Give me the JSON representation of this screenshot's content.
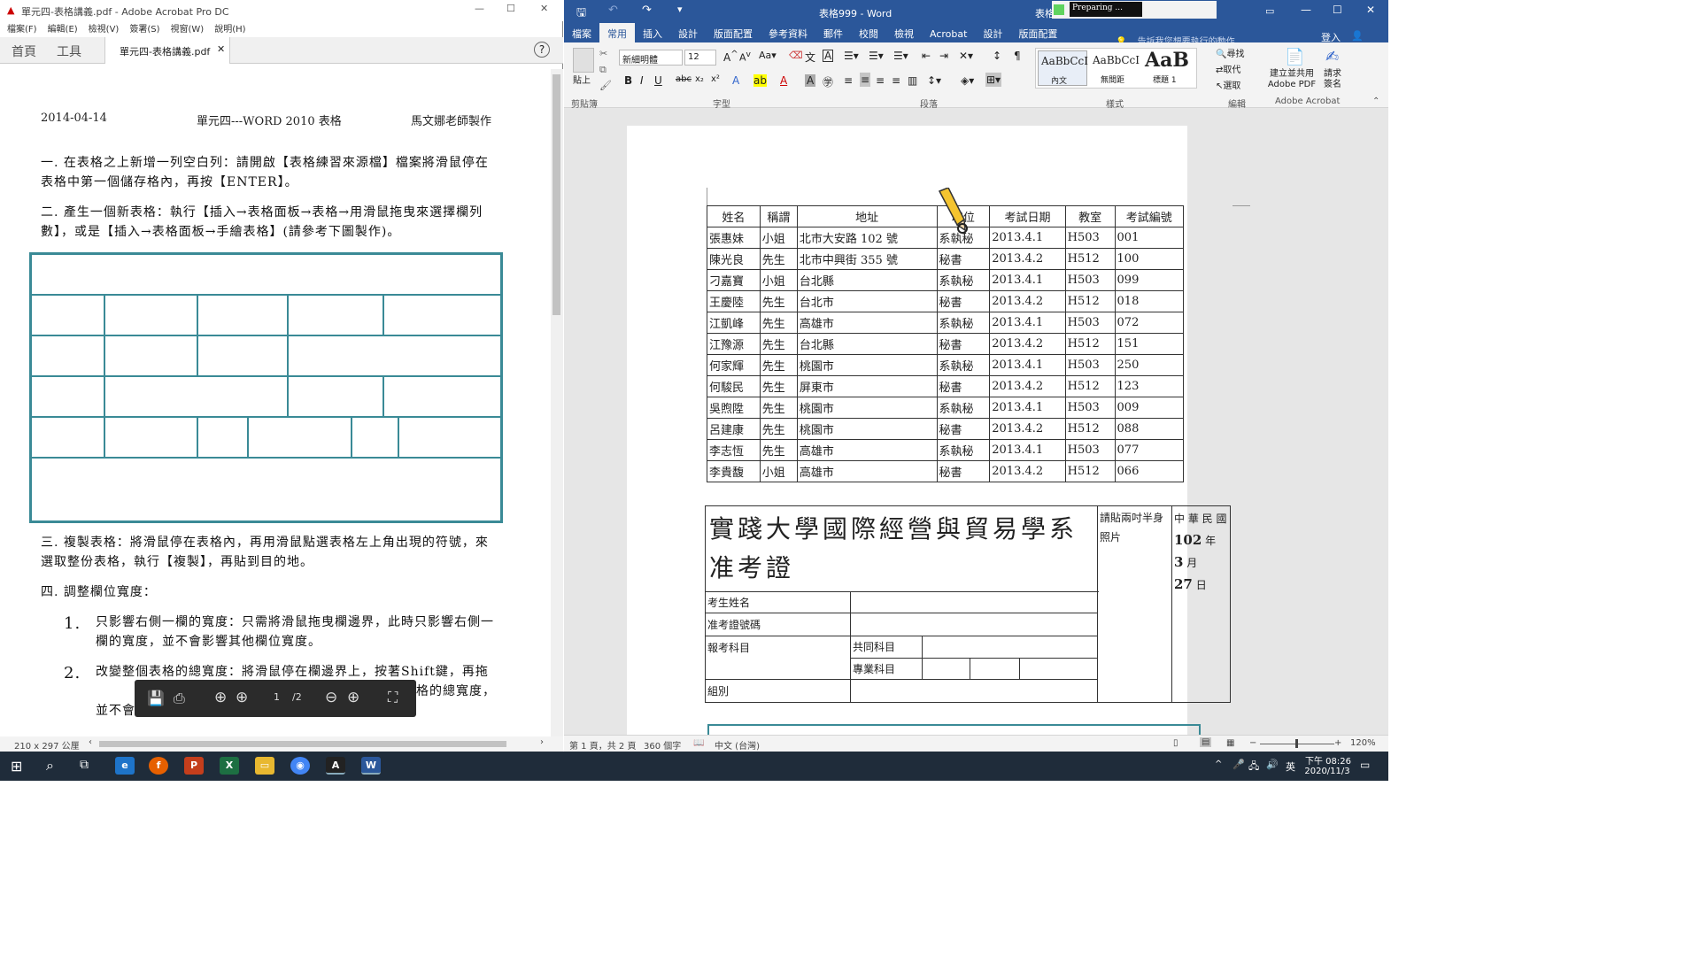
{
  "acrobat": {
    "window_title": "單元四-表格講義.pdf - Adobe Acrobat Pro DC",
    "menu": [
      "檔案(F)",
      "編輯(E)",
      "檢視(V)",
      "簽署(S)",
      "視窗(W)",
      "說明(H)"
    ],
    "tab_home": "首頁",
    "tab_tools": "工具",
    "doc_tab": "單元四-表格講義.pdf",
    "doc": {
      "date": "2014-04-14",
      "header_title": "單元四---WORD 2010 表格",
      "author": "馬文娜老師製作",
      "step1": "一. 在表格之上新增一列空白列：請開啟【表格練習來源檔】檔案將滑鼠停在表格中第一個儲存格內，再按【ENTER】。",
      "step2": "二. 產生一個新表格：執行【插入→表格面板→表格→用滑鼠拖曳來選擇欄列數】，或是【插入→表格面板→手繪表格】(請參考下圖製作)。",
      "step3": "三. 複製表格：將滑鼠停在表格內，再用滑鼠點選表格左上角出現的符號，來選取整份表格，執行【複製】，再貼到目的地。",
      "step4": "四. 調整欄位寬度：",
      "sub1_num": "1.",
      "sub1": "只影響右側一欄的寬度：只需將滑鼠拖曳欄邊界，此時只影響右側一欄的寬度，並不會影響其他欄位寬度。",
      "sub2_num": "2.",
      "sub2": "改變整個表格的總寬度：將滑鼠停在欄邊界上，按著Shift鍵，再拖曳滑鼠",
      "sub2_tail": "格的總寬度，",
      "sub2_tail2": "並不會"
    },
    "toolbar": {
      "page_current": "1",
      "page_total": "/2"
    },
    "page_size": "210 x 297 公厘"
  },
  "word": {
    "window_title": "表格999 - Word",
    "progress_text": "Preparing ...",
    "table_label": "表格",
    "tabs": [
      "檔案",
      "常用",
      "插入",
      "設計",
      "版面配置",
      "參考資料",
      "郵件",
      "校閱",
      "檢視",
      "Acrobat",
      "設計",
      "版面配置"
    ],
    "tell_me": "告訴我您想要執行的動作...",
    "signin": "登入",
    "share": "共用",
    "ribbon": {
      "paste": "貼上",
      "font_name": "新細明體",
      "font_size": "12",
      "style1": "AaBbCcI",
      "style1_name": "內文",
      "style2": "AaBbCcI",
      "style2_name": "無間距",
      "style3": "AaB",
      "style3_name": "標題 1",
      "find": "尋找",
      "replace": "取代",
      "select": "選取",
      "create_pdf": "建立並共用 Adobe PDF",
      "request_sign": "請求簽名",
      "groups": [
        "剪貼簿",
        "字型",
        "段落",
        "樣式",
        "編輯",
        "Adobe Acrobat"
      ]
    },
    "table_headers": [
      "姓名",
      "稱謂",
      "地址",
      "職位",
      "考試日期",
      "教室",
      "考試編號"
    ],
    "table_rows": [
      [
        "張惠妹",
        "小姐",
        "北市大安路 102 號",
        "系執秘",
        "2013.4.1",
        "H503",
        "001"
      ],
      [
        "陳光良",
        "先生",
        "北市中興街 355 號",
        "秘書",
        "2013.4.2",
        "H512",
        "100"
      ],
      [
        "刁嘉寶",
        "小姐",
        "台北縣",
        "系執秘",
        "2013.4.1",
        "H503",
        "099"
      ],
      [
        "王慶陸",
        "先生",
        "台北市",
        "秘書",
        "2013.4.2",
        "H512",
        "018"
      ],
      [
        "江凱峰",
        "先生",
        "高雄市",
        "系執秘",
        "2013.4.1",
        "H503",
        "072"
      ],
      [
        "江豫源",
        "先生",
        "台北縣",
        "秘書",
        "2013.4.2",
        "H512",
        "151"
      ],
      [
        "何家輝",
        "先生",
        "桃園市",
        "系執秘",
        "2013.4.1",
        "H503",
        "250"
      ],
      [
        "何駿民",
        "先生",
        "屏東市",
        "秘書",
        "2013.4.2",
        "H512",
        "123"
      ],
      [
        "吳煦陞",
        "先生",
        "桃園市",
        "系執秘",
        "2013.4.1",
        "H503",
        "009"
      ],
      [
        "呂建康",
        "先生",
        "桃園市",
        "秘書",
        "2013.4.2",
        "H512",
        "088"
      ],
      [
        "李志恆",
        "先生",
        "高雄市",
        "系執秘",
        "2013.4.1",
        "H503",
        "077"
      ],
      [
        "李貴馥",
        "小姐",
        "高雄市",
        "秘書",
        "2013.4.2",
        "H512",
        "066"
      ]
    ],
    "exam": {
      "title": "實踐大學國際經營與貿易學系准考證",
      "photo": "請貼兩吋半身照片",
      "roc": "中 華 民 國",
      "year": "102",
      "year_unit": "年",
      "month": "3",
      "month_unit": "月",
      "day": "27",
      "day_unit": "日",
      "name_label": "考生姓名",
      "id_label": "准考證號碼",
      "subject_label": "報考科目",
      "common_label": "共同科目",
      "major_label": "專業科目",
      "group_label": "組別"
    },
    "status": {
      "page": "第 1 頁，共 2 頁",
      "words": "360 個字",
      "lang": "中文 (台灣)",
      "zoom": "120%"
    }
  },
  "taskbar": {
    "ime": "英",
    "time": "下午 08:26",
    "date": "2020/11/3"
  }
}
